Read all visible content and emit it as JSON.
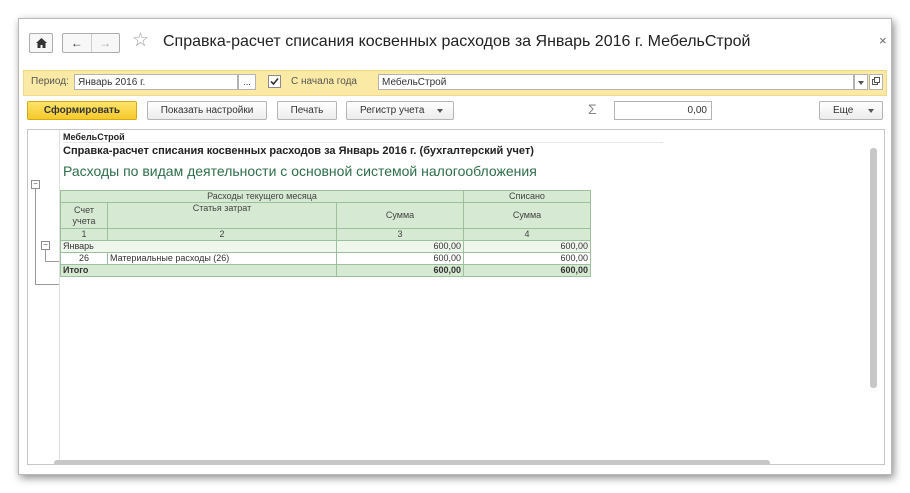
{
  "window": {
    "title": "Справка-расчет списания косвенных расходов за Январь 2016 г. МебельСтрой",
    "close_glyph": "×"
  },
  "params": {
    "period_label": "Период:",
    "period_value": "Январь 2016 г.",
    "period_btn": "...",
    "from_year_start_label": "С начала года",
    "from_year_start_checked": true,
    "org_value": "МебельСтрой"
  },
  "toolbar": {
    "generate_label": "Сформировать",
    "show_settings_label": "Показать настройки",
    "print_label": "Печать",
    "register_label": "Регистр учета",
    "sum_value": "0,00",
    "more_label": "Еще"
  },
  "report": {
    "org": "МебельСтрой",
    "title": "Справка-расчет списания косвенных расходов за Январь 2016 г. (бухгалтерский учет)",
    "subtitle": "Расходы по видам деятельности с основной системой налогообложения",
    "header": {
      "group_current": "Расходы текущего месяца",
      "group_written": "Списано",
      "col_account": "Счет учета",
      "col_cost_item": "Статья затрат",
      "col_sum": "Сумма",
      "col_written_sum": "Сумма",
      "num1": "1",
      "num2": "2",
      "num3": "3",
      "num4": "4"
    },
    "group_row": {
      "label": "Январь",
      "sum": "600,00",
      "written": "600,00"
    },
    "rows": [
      {
        "account": "26",
        "item": "Материальные расходы (26)",
        "sum": "600,00",
        "written": "600,00"
      }
    ],
    "total": {
      "label": "Итого",
      "sum": "600,00",
      "written": "600,00"
    }
  },
  "colors": {
    "accent": "#f4c92b",
    "params_bg": "#fbeaa5",
    "header_green": "#d6e9d2",
    "subtitle_green": "#2e6e4a"
  }
}
